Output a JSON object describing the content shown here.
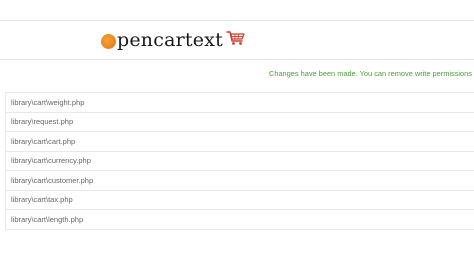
{
  "header": {
    "logo_text": "pencartext",
    "logo_icon": "shopping-cart-icon",
    "logo_dot_color": "#e8821c",
    "cart_color": "#d0392b"
  },
  "notice": {
    "text": "Changes have been made. You can remove write permissions from",
    "color": "#4a9f35"
  },
  "files": [
    {
      "path": "library\\cart\\weight.php"
    },
    {
      "path": "library\\request.php"
    },
    {
      "path": "library\\cart\\cart.php"
    },
    {
      "path": "library\\cart\\currency.php"
    },
    {
      "path": "library\\cart\\customer.php"
    },
    {
      "path": "library\\cart\\tax.php"
    },
    {
      "path": "library\\cart\\length.php"
    }
  ]
}
